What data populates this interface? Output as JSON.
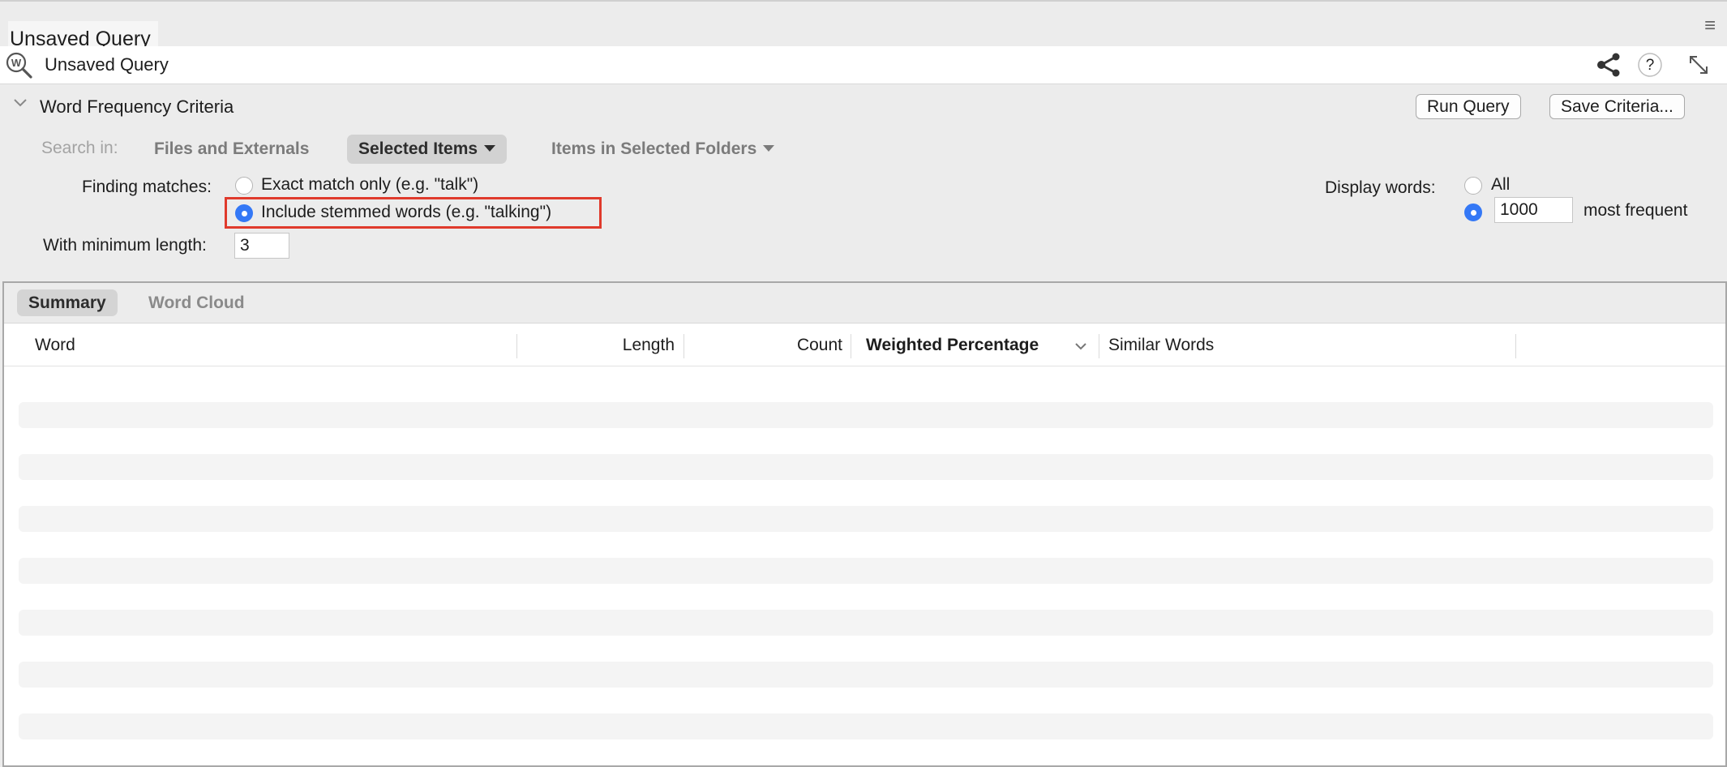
{
  "window": {
    "tab_title": "Unsaved Query"
  },
  "header": {
    "query_title": "Unsaved Query",
    "icons": [
      "share-icon",
      "help-icon",
      "expand-icon"
    ]
  },
  "criteria": {
    "section_title": "Word Frequency Criteria",
    "run_button": "Run Query",
    "save_button": "Save Criteria...",
    "search_in_label": "Search in:",
    "scope_options": [
      "Files and Externals",
      "Selected Items",
      "Items in Selected Folders"
    ],
    "selected_scope": "Selected Items",
    "finding_matches_label": "Finding matches:",
    "match_options": [
      "Exact match only (e.g. \"talk\")",
      "Include stemmed words (e.g. \"talking\")"
    ],
    "selected_match": "Include stemmed words (e.g. \"talking\")",
    "min_length_label": "With minimum length:",
    "min_length_value": "3",
    "display_words_label": "Display words:",
    "display_all_label": "All",
    "display_count_value": "1000",
    "display_count_suffix": "most frequent",
    "selected_display": "count"
  },
  "results": {
    "tabs": [
      "Summary",
      "Word Cloud"
    ],
    "active_tab": "Summary",
    "columns": [
      "Word",
      "Length",
      "Count",
      "Weighted Percentage",
      "Similar Words"
    ],
    "sorted_column": "Weighted Percentage",
    "rows": []
  },
  "colors": {
    "accent": "#3478f6",
    "highlight": "#e03a2c"
  }
}
